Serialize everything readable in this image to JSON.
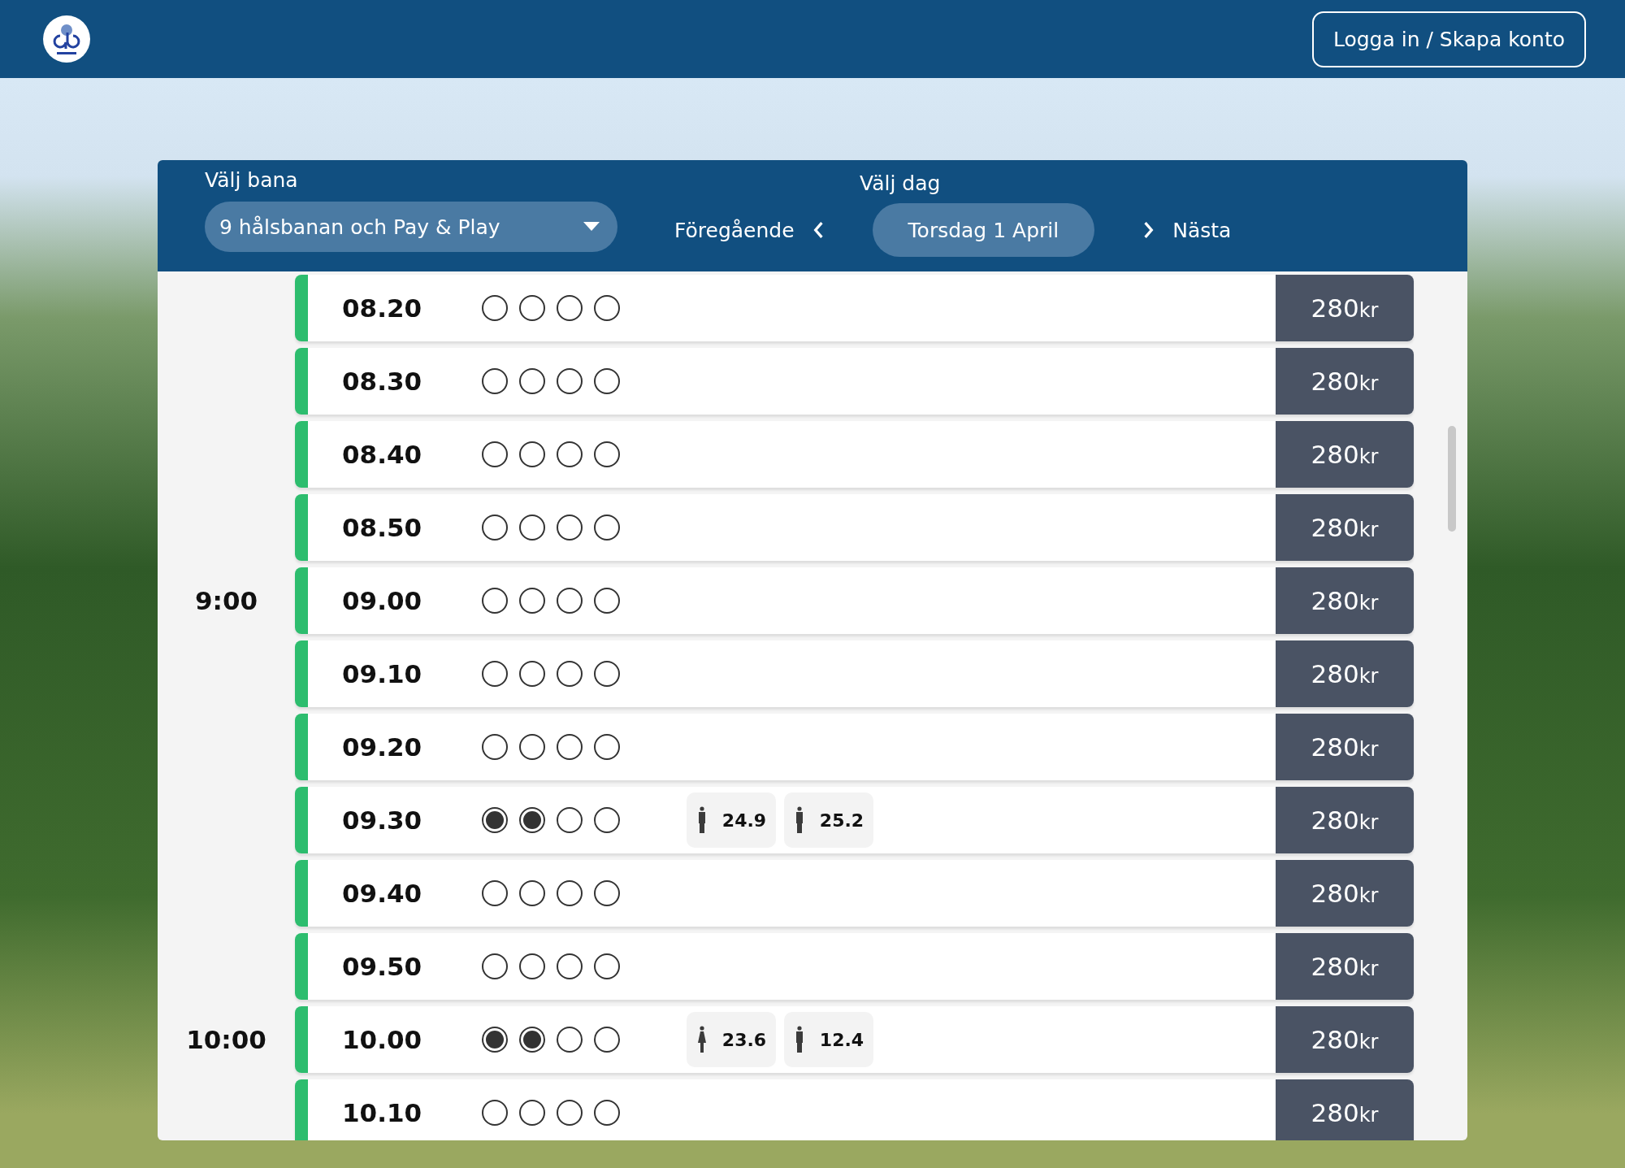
{
  "header": {
    "login_button": "Logga in / Skapa konto"
  },
  "filters": {
    "course_label": "Välj bana",
    "course_value": "9 hålsbanan och Pay & Play",
    "day_label": "Välj dag",
    "previous": "Föregående",
    "day_value": "Torsdag 1 April",
    "next": "Nästa"
  },
  "rows": [
    {
      "time": "08.20",
      "slots": [
        false,
        false,
        false,
        false
      ],
      "players": [],
      "price": "280",
      "currency": "kr"
    },
    {
      "time": "08.30",
      "slots": [
        false,
        false,
        false,
        false
      ],
      "players": [],
      "price": "280",
      "currency": "kr"
    },
    {
      "time": "08.40",
      "slots": [
        false,
        false,
        false,
        false
      ],
      "players": [],
      "price": "280",
      "currency": "kr"
    },
    {
      "time": "08.50",
      "slots": [
        false,
        false,
        false,
        false
      ],
      "players": [],
      "price": "280",
      "currency": "kr"
    },
    {
      "hour_label": "9:00",
      "time": "09.00",
      "slots": [
        false,
        false,
        false,
        false
      ],
      "players": [],
      "price": "280",
      "currency": "kr"
    },
    {
      "time": "09.10",
      "slots": [
        false,
        false,
        false,
        false
      ],
      "players": [],
      "price": "280",
      "currency": "kr"
    },
    {
      "time": "09.20",
      "slots": [
        false,
        false,
        false,
        false
      ],
      "players": [],
      "price": "280",
      "currency": "kr"
    },
    {
      "time": "09.30",
      "slots": [
        true,
        true,
        false,
        false
      ],
      "players": [
        {
          "kind": "male",
          "handicap": "24.9"
        },
        {
          "kind": "male",
          "handicap": "25.2"
        }
      ],
      "price": "280",
      "currency": "kr"
    },
    {
      "time": "09.40",
      "slots": [
        false,
        false,
        false,
        false
      ],
      "players": [],
      "price": "280",
      "currency": "kr"
    },
    {
      "time": "09.50",
      "slots": [
        false,
        false,
        false,
        false
      ],
      "players": [],
      "price": "280",
      "currency": "kr"
    },
    {
      "hour_label": "10:00",
      "time": "10.00",
      "slots": [
        true,
        true,
        false,
        false
      ],
      "players": [
        {
          "kind": "female",
          "handicap": "23.6"
        },
        {
          "kind": "male",
          "handicap": "12.4"
        }
      ],
      "price": "280",
      "currency": "kr"
    },
    {
      "time": "10.10",
      "slots": [
        false,
        false,
        false,
        false
      ],
      "players": [],
      "price": "280",
      "currency": "kr"
    }
  ]
}
